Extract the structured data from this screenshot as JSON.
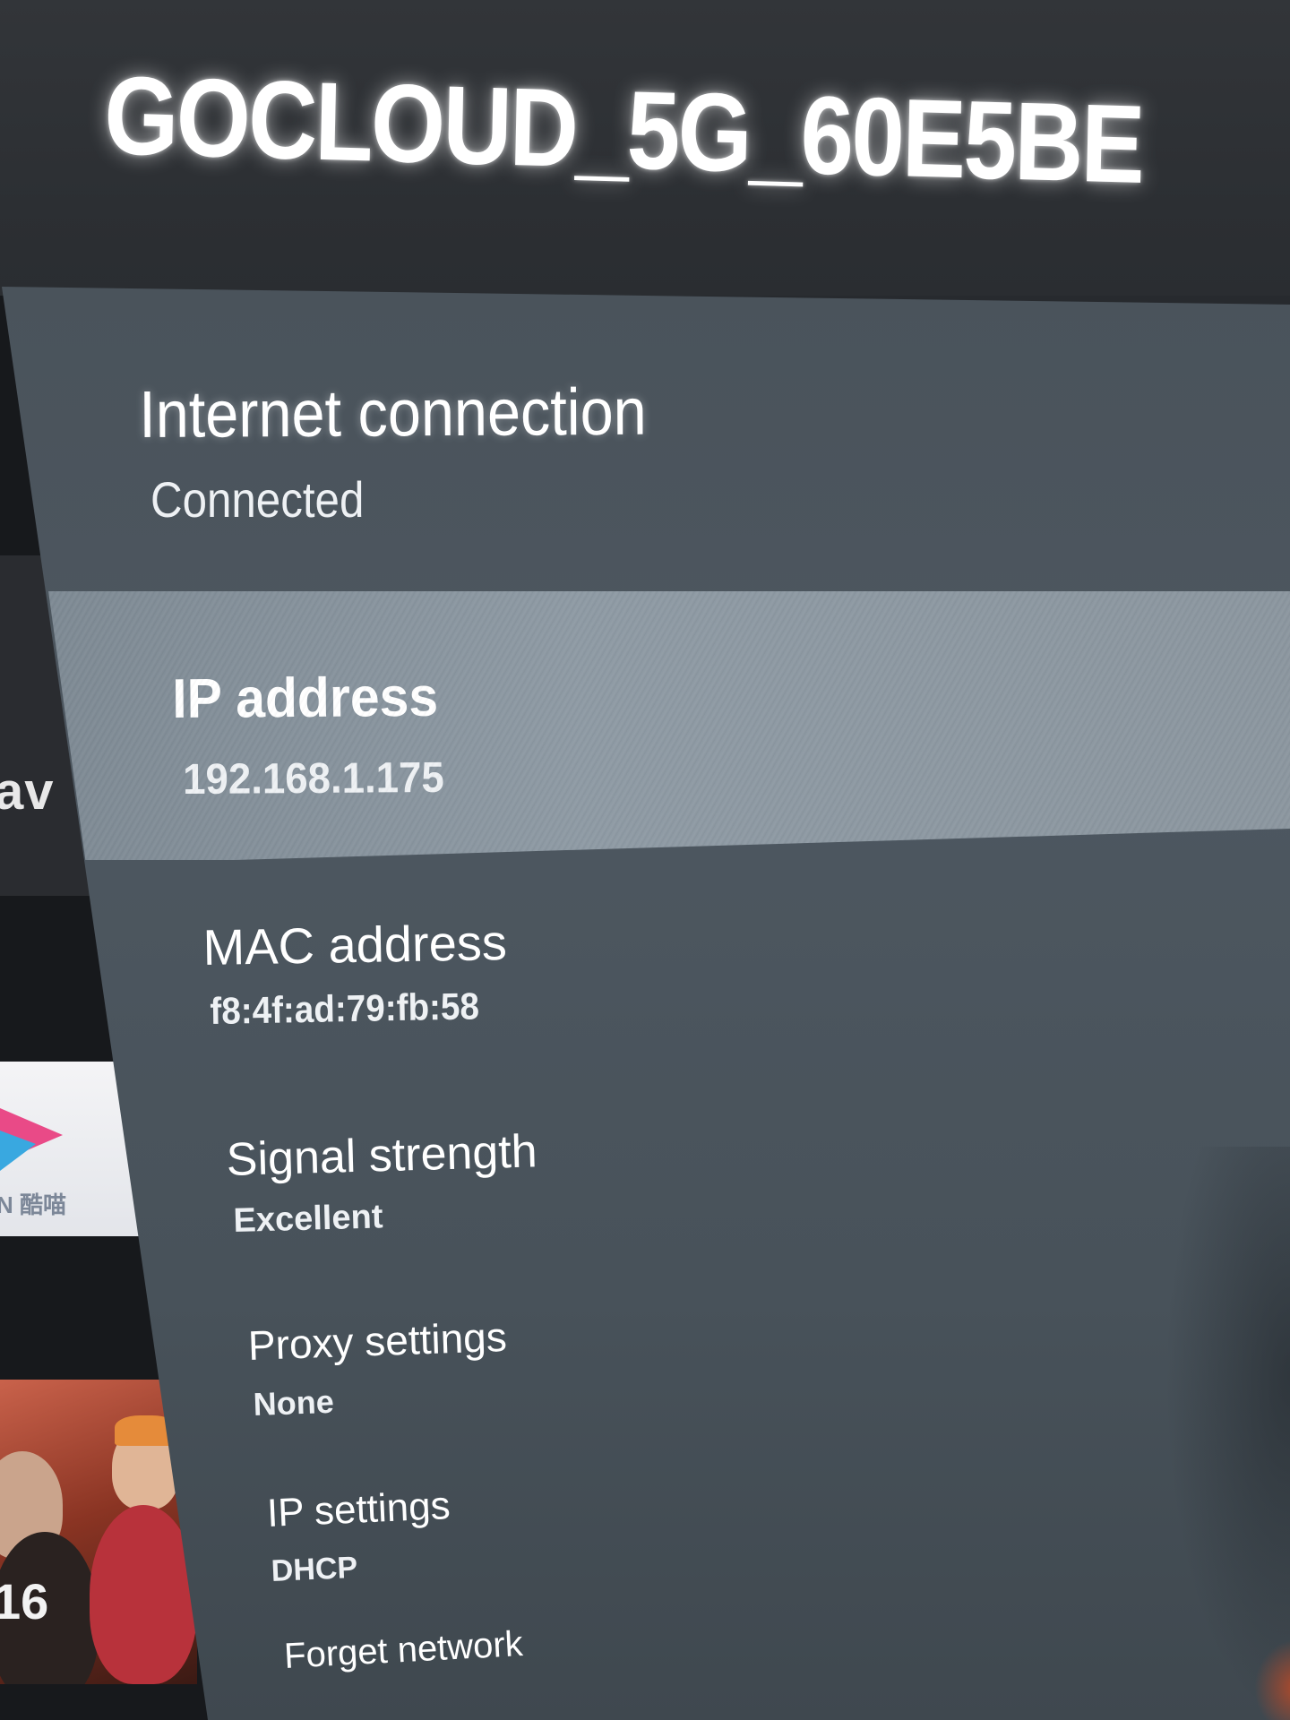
{
  "header": {
    "network_name": "GOCLOUD_5G_60E5BE"
  },
  "settings": {
    "internet_connection": {
      "title": "Internet connection",
      "value": "Connected"
    },
    "ip_address": {
      "title": "IP address",
      "value": "192.168.1.175"
    },
    "mac_address": {
      "title": "MAC address",
      "value": "f8:4f:ad:79:fb:58"
    },
    "signal_strength": {
      "title": "Signal strength",
      "value": "Excellent"
    },
    "proxy_settings": {
      "title": "Proxy settings",
      "value": "None"
    },
    "ip_settings": {
      "title": "IP settings",
      "value": "DHCP"
    },
    "forget_network": {
      "title": "Forget network"
    }
  },
  "background": {
    "partial_text": "av",
    "app_caption": "N 酷喵",
    "poster_number": "16"
  },
  "colors": {
    "panel": "#4d5760",
    "focused_row": "#8a959e",
    "text": "#ffffff"
  }
}
